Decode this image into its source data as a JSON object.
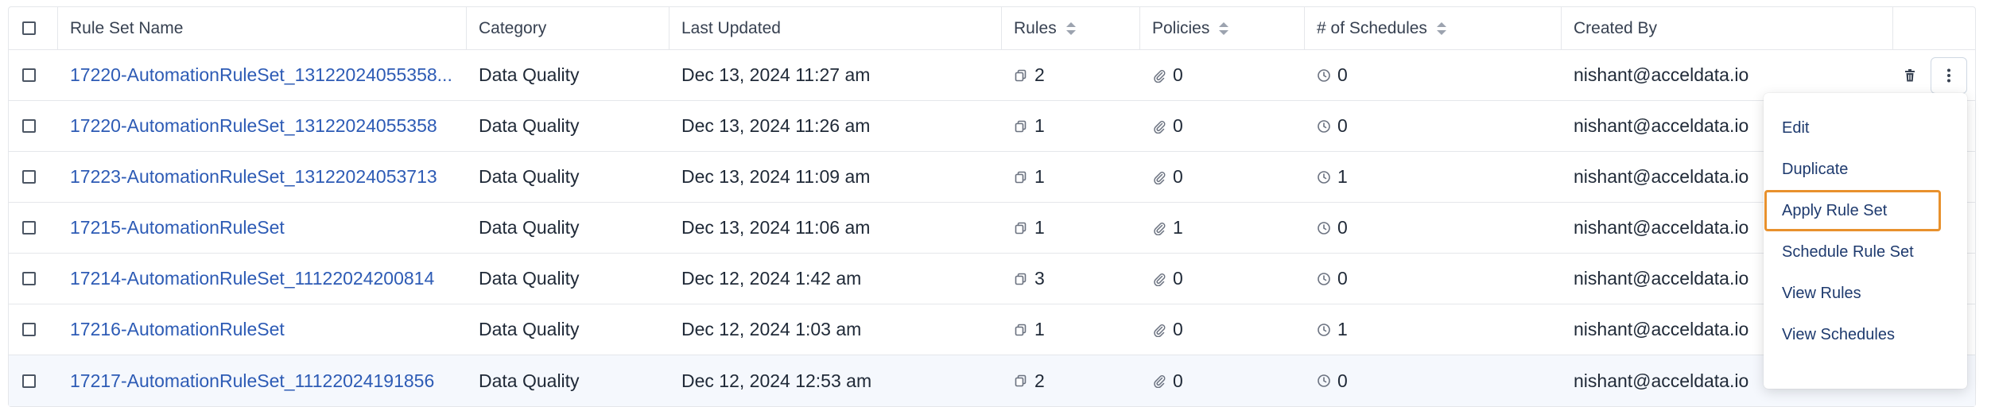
{
  "columns": {
    "name": "Rule Set Name",
    "category": "Category",
    "updated": "Last Updated",
    "rules": "Rules",
    "policies": "Policies",
    "schedules": "# of Schedules",
    "created_by": "Created By"
  },
  "rows": [
    {
      "name": "17220-AutomationRuleSet_13122024055358...",
      "category": "Data Quality",
      "updated": "Dec 13, 2024 11:27 am",
      "rules": "2",
      "policies": "0",
      "schedules": "0",
      "created_by": "nishant@acceldata.io"
    },
    {
      "name": "17220-AutomationRuleSet_13122024055358",
      "category": "Data Quality",
      "updated": "Dec 13, 2024 11:26 am",
      "rules": "1",
      "policies": "0",
      "schedules": "0",
      "created_by": "nishant@acceldata.io"
    },
    {
      "name": "17223-AutomationRuleSet_13122024053713",
      "category": "Data Quality",
      "updated": "Dec 13, 2024 11:09 am",
      "rules": "1",
      "policies": "0",
      "schedules": "1",
      "created_by": "nishant@acceldata.io"
    },
    {
      "name": "17215-AutomationRuleSet",
      "category": "Data Quality",
      "updated": "Dec 13, 2024 11:06 am",
      "rules": "1",
      "policies": "1",
      "schedules": "0",
      "created_by": "nishant@acceldata.io"
    },
    {
      "name": "17214-AutomationRuleSet_11122024200814",
      "category": "Data Quality",
      "updated": "Dec 12, 2024 1:42 am",
      "rules": "3",
      "policies": "0",
      "schedules": "0",
      "created_by": "nishant@acceldata.io"
    },
    {
      "name": "17216-AutomationRuleSet",
      "category": "Data Quality",
      "updated": "Dec 12, 2024 1:03 am",
      "rules": "1",
      "policies": "0",
      "schedules": "1",
      "created_by": "nishant@acceldata.io"
    },
    {
      "name": "17217-AutomationRuleSet_11122024191856",
      "category": "Data Quality",
      "updated": "Dec 12, 2024 12:53 am",
      "rules": "2",
      "policies": "0",
      "schedules": "0",
      "created_by": "nishant@acceldata.io"
    }
  ],
  "menu": {
    "items": [
      "Edit",
      "Duplicate",
      "Apply Rule Set",
      "Schedule Rule Set",
      "View Rules",
      "View Schedules"
    ],
    "focused": "Apply Rule Set"
  },
  "colors": {
    "link": "#2d5bb5",
    "focus_outline": "#e8912d",
    "row_highlight": "#f5f8fd"
  },
  "icons": {
    "rules": "copy-icon",
    "policies": "paperclip-icon",
    "schedules": "clock-icon",
    "row_delete": "trash-icon",
    "row_menu": "more-vertical-icon"
  }
}
